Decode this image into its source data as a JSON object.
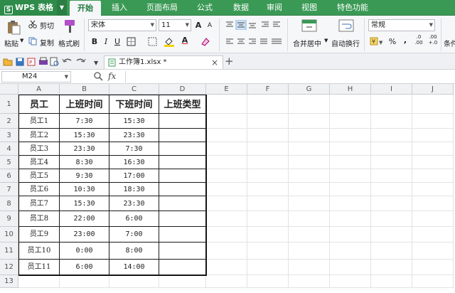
{
  "app": {
    "name": "WPS 表格",
    "logo_letter": "S"
  },
  "menu_tabs": [
    "开始",
    "插入",
    "页面布局",
    "公式",
    "数据",
    "审阅",
    "视图",
    "特色功能"
  ],
  "active_tab": 0,
  "ribbon": {
    "paste": "粘贴",
    "cut": "剪切",
    "copy": "复制",
    "format_painter": "格式刷",
    "font_name": "宋体",
    "font_size": "11",
    "bold": "B",
    "italic": "I",
    "underline": "U",
    "grow_font": "A",
    "shrink_font": "A",
    "merge_center": "合并居中",
    "wrap_text": "自动换行",
    "number_format": "常规",
    "percent": "%",
    "thousands": ",",
    "inc_decimal_top": ".0",
    "inc_decimal_bottom": ".00",
    "dec_decimal_top": ".00",
    "dec_decimal_bottom": "+.0",
    "conditional": "条件"
  },
  "document": {
    "tab_name": "工作簿1.xlsx *",
    "close": "×",
    "add": "+"
  },
  "formula_bar": {
    "name_box": "M24",
    "fx": "fx",
    "value": ""
  },
  "columns": [
    "A",
    "B",
    "C",
    "D",
    "E",
    "F",
    "G",
    "H",
    "I",
    "J"
  ],
  "rows": [
    "1",
    "2",
    "3",
    "4",
    "5",
    "6",
    "7",
    "8",
    "9",
    "10",
    "11",
    "12",
    "13"
  ],
  "table": {
    "headers": [
      "员工",
      "上班时间",
      "下班时间",
      "上班类型"
    ],
    "rows": [
      [
        "员工1",
        "7:30",
        "15:30",
        ""
      ],
      [
        "员工2",
        "15:30",
        "23:30",
        ""
      ],
      [
        "员工3",
        "23:30",
        "7:30",
        ""
      ],
      [
        "员工4",
        "8:30",
        "16:30",
        ""
      ],
      [
        "员工5",
        "9:30",
        "17:00",
        ""
      ],
      [
        "员工6",
        "10:30",
        "18:30",
        ""
      ],
      [
        "员工7",
        "15:30",
        "23:30",
        ""
      ],
      [
        "员工8",
        "22:00",
        "6:00",
        ""
      ],
      [
        "员工9",
        "23:00",
        "7:00",
        ""
      ],
      [
        "员工10",
        "0:00",
        "8:00",
        ""
      ],
      [
        "员工11",
        "6:00",
        "14:00",
        ""
      ]
    ]
  },
  "colors": {
    "brand": "#3a9a55",
    "active_tab_text": "#1f7a3b",
    "header_bg": "#f0f1f3"
  }
}
